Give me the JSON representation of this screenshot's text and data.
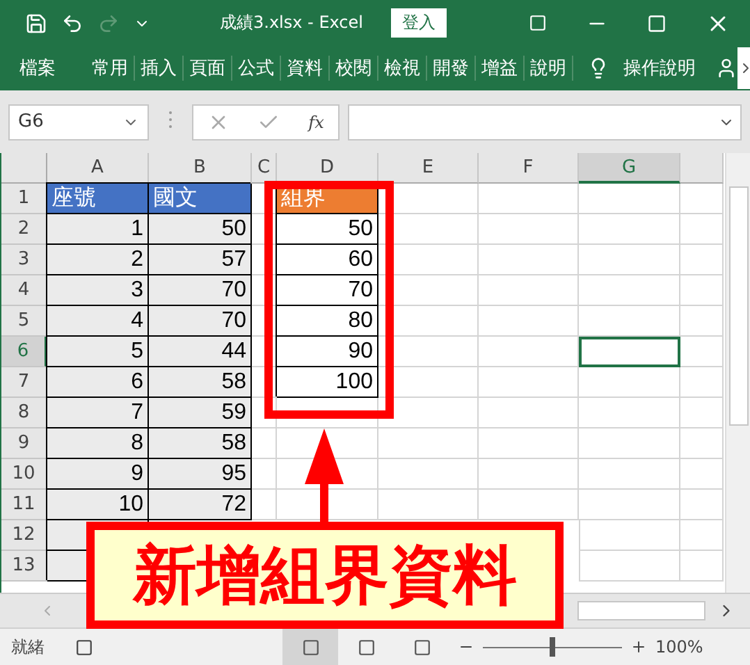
{
  "title_bar": {
    "title": "成績3.xlsx  -  Excel",
    "sign_in": "登入",
    "redo_disabled": true
  },
  "ribbon_tabs": [
    {
      "label": "檔案",
      "selected": false
    },
    {
      "label": "常用",
      "selected": false
    },
    {
      "label": "插入",
      "selected": false
    },
    {
      "label": "頁面",
      "selected": false
    },
    {
      "label": "公式",
      "selected": false
    },
    {
      "label": "資料",
      "selected": false
    },
    {
      "label": "校閱",
      "selected": false
    },
    {
      "label": "檢視",
      "selected": false
    },
    {
      "label": "開發",
      "selected": false
    },
    {
      "label": "增益",
      "selected": false
    },
    {
      "label": "說明",
      "selected": false
    }
  ],
  "tell_me": "操作說明",
  "formula_bar": {
    "name_box": "G6",
    "function_label": "fx"
  },
  "columns": [
    {
      "label": "A",
      "selected": false
    },
    {
      "label": "B",
      "selected": false
    },
    {
      "label": "C",
      "selected": false
    },
    {
      "label": "D",
      "selected": false
    },
    {
      "label": "E",
      "selected": false
    },
    {
      "label": "F",
      "selected": false
    },
    {
      "label": "G",
      "selected": true
    }
  ],
  "rows": [
    {
      "label": "1",
      "selected": false,
      "cells": [
        {
          "kind": "header",
          "text": "座號",
          "color": "#4472c4"
        },
        {
          "kind": "header",
          "text": "國文",
          "color": "#4472c4"
        },
        null,
        {
          "kind": "header",
          "text": "組界",
          "color": "#ed7d31"
        }
      ]
    },
    {
      "label": "2",
      "selected": false,
      "cells": [
        {
          "kind": "value",
          "text": "1",
          "shaded": true
        },
        {
          "kind": "value",
          "text": "50",
          "shaded": true
        },
        null,
        {
          "kind": "value",
          "text": "50",
          "shaded": false
        }
      ]
    },
    {
      "label": "3",
      "selected": false,
      "cells": [
        {
          "kind": "value",
          "text": "2",
          "shaded": true
        },
        {
          "kind": "value",
          "text": "57",
          "shaded": true
        },
        null,
        {
          "kind": "value",
          "text": "60",
          "shaded": false
        }
      ]
    },
    {
      "label": "4",
      "selected": false,
      "cells": [
        {
          "kind": "value",
          "text": "3",
          "shaded": true
        },
        {
          "kind": "value",
          "text": "70",
          "shaded": true
        },
        null,
        {
          "kind": "value",
          "text": "70",
          "shaded": false
        }
      ]
    },
    {
      "label": "5",
      "selected": false,
      "cells": [
        {
          "kind": "value",
          "text": "4",
          "shaded": true
        },
        {
          "kind": "value",
          "text": "70",
          "shaded": true
        },
        null,
        {
          "kind": "value",
          "text": "80",
          "shaded": false
        }
      ]
    },
    {
      "label": "6",
      "selected": true,
      "cells": [
        {
          "kind": "value",
          "text": "5",
          "shaded": true
        },
        {
          "kind": "value",
          "text": "44",
          "shaded": true
        },
        null,
        {
          "kind": "value",
          "text": "90",
          "shaded": false
        }
      ]
    },
    {
      "label": "7",
      "selected": false,
      "cells": [
        {
          "kind": "value",
          "text": "6",
          "shaded": true
        },
        {
          "kind": "value",
          "text": "58",
          "shaded": true
        },
        null,
        {
          "kind": "value",
          "text": "100",
          "shaded": false
        }
      ]
    },
    {
      "label": "8",
      "selected": false,
      "cells": [
        {
          "kind": "value",
          "text": "7",
          "shaded": true
        },
        {
          "kind": "value",
          "text": "59",
          "shaded": true
        }
      ]
    },
    {
      "label": "9",
      "selected": false,
      "cells": [
        {
          "kind": "value",
          "text": "8",
          "shaded": true
        },
        {
          "kind": "value",
          "text": "58",
          "shaded": true
        }
      ]
    },
    {
      "label": "10",
      "selected": false,
      "cells": [
        {
          "kind": "value",
          "text": "9",
          "shaded": true
        },
        {
          "kind": "value",
          "text": "95",
          "shaded": true
        }
      ]
    },
    {
      "label": "11",
      "selected": false,
      "cells": [
        {
          "kind": "value",
          "text": "10",
          "shaded": true
        },
        {
          "kind": "value",
          "text": "72",
          "shaded": true
        }
      ]
    },
    {
      "label": "12",
      "selected": false,
      "cells": [
        {
          "kind": "value",
          "shaded": true
        }
      ]
    },
    {
      "label": "13",
      "selected": false,
      "cells": [
        {
          "kind": "value",
          "shaded": true
        }
      ]
    }
  ],
  "status_bar": {
    "status": "就緒",
    "level": 0.5,
    "zoom": "100%",
    "views": [
      {
        "selected": true
      },
      {
        "selected": false
      },
      {
        "selected": false
      }
    ]
  },
  "annotation": {
    "text": "新增組界資料"
  }
}
